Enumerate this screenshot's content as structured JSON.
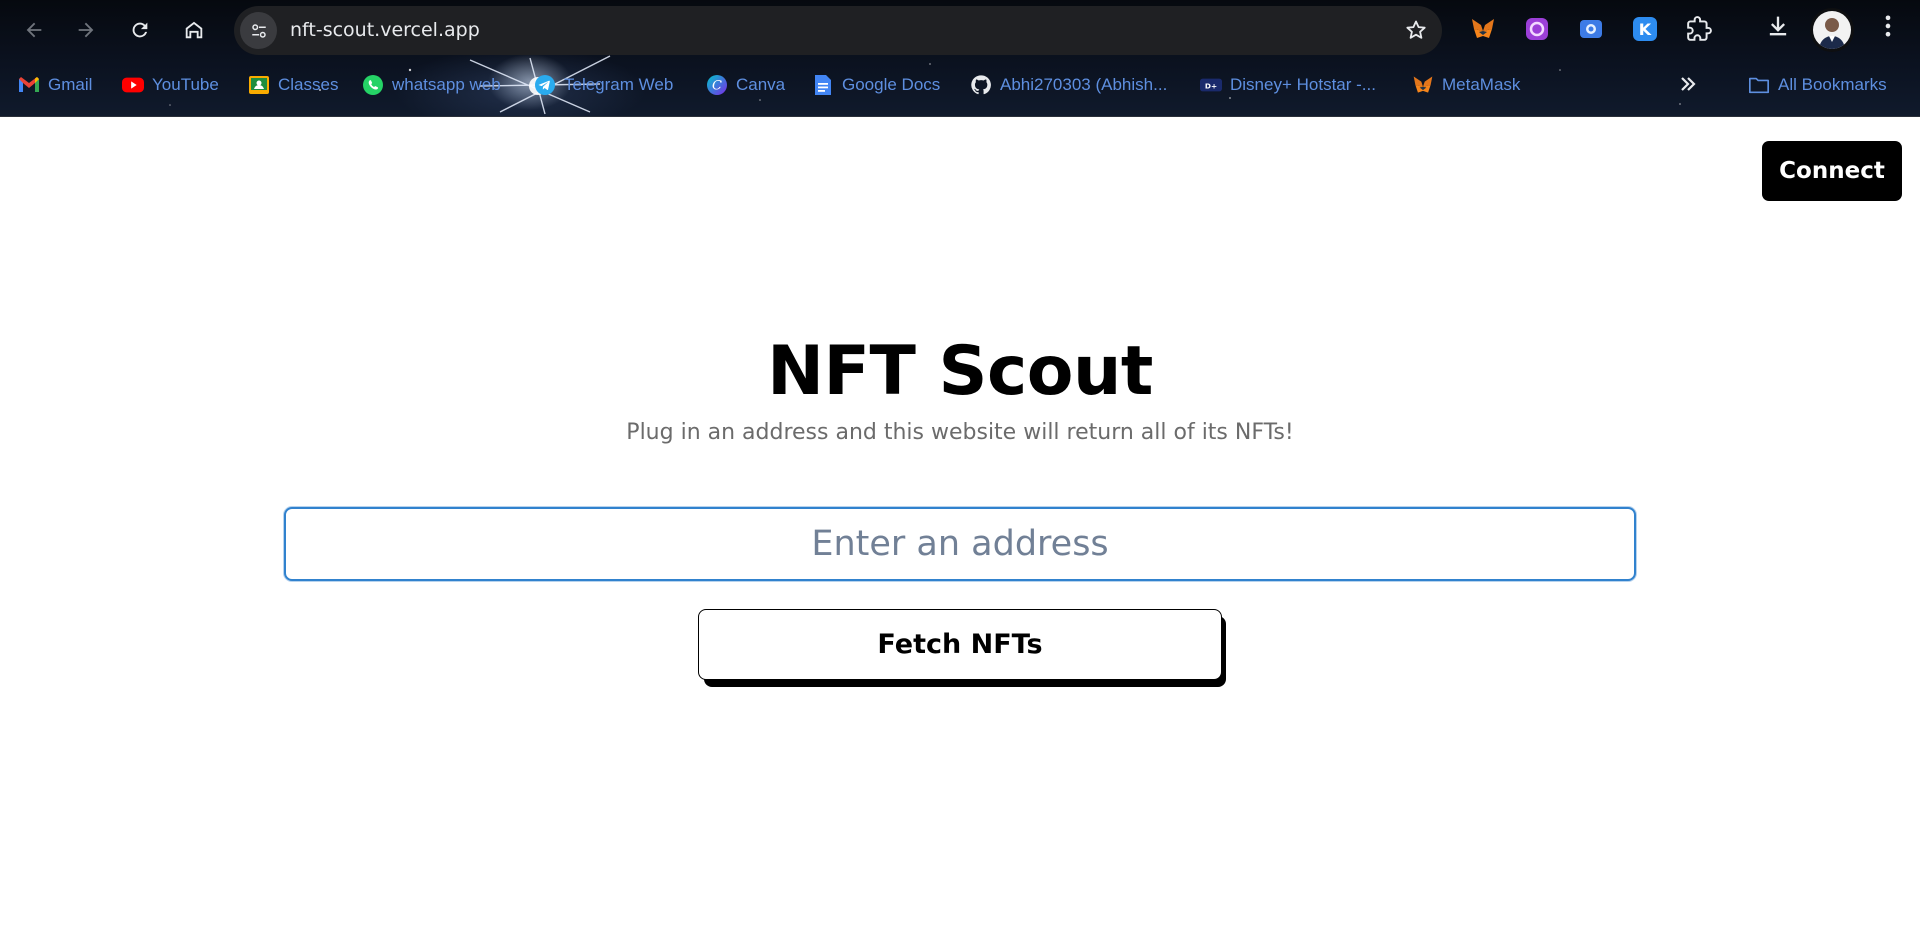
{
  "browser": {
    "url": "nft-scout.vercel.app",
    "bookmarks": [
      {
        "label": "Gmail",
        "icon": "gmail-icon"
      },
      {
        "label": "YouTube",
        "icon": "youtube-icon"
      },
      {
        "label": "Classes",
        "icon": "classroom-icon"
      },
      {
        "label": "whatsapp web",
        "icon": "whatsapp-icon"
      },
      {
        "label": "Telegram Web",
        "icon": "telegram-icon"
      },
      {
        "label": "Canva",
        "icon": "canva-icon"
      },
      {
        "label": "Google Docs",
        "icon": "docs-icon"
      },
      {
        "label": "Abhi270303 (Abhish...",
        "icon": "github-icon"
      },
      {
        "label": "Disney+ Hotstar -...",
        "icon": "hotstar-icon"
      },
      {
        "label": "MetaMask",
        "icon": "metamask-icon"
      }
    ],
    "all_bookmarks_label": "All Bookmarks"
  },
  "page": {
    "connect_label": "Connect",
    "title": "NFT Scout",
    "subtitle": "Plug in an address and this website will return all of its NFTs!",
    "address_placeholder": "Enter an address",
    "fetch_label": "Fetch NFTs"
  },
  "colors": {
    "input_border": "#3182ce",
    "button_bg": "#000000",
    "subtitle": "#6b6b6b",
    "bookmark_text": "#5e8fe0"
  }
}
